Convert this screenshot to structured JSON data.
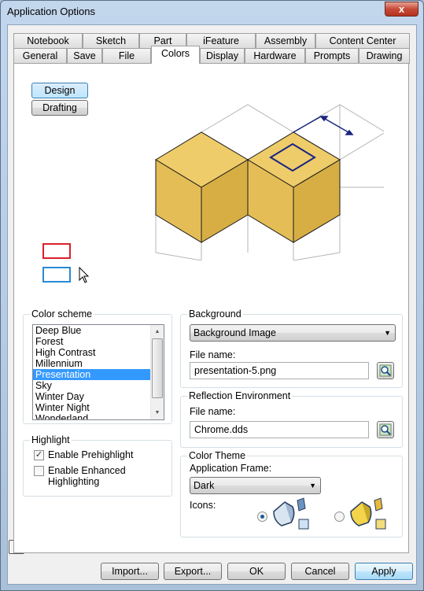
{
  "window": {
    "title": "Application Options",
    "close_label": "x"
  },
  "tabs": {
    "row1": [
      "Notebook",
      "Sketch",
      "Part",
      "iFeature",
      "Assembly",
      "Content Center"
    ],
    "row2": [
      "General",
      "Save",
      "File",
      "Colors",
      "Display",
      "Hardware",
      "Prompts",
      "Drawing"
    ],
    "active": "Colors"
  },
  "mode_buttons": {
    "design": "Design",
    "drafting": "Drafting",
    "active": "Design"
  },
  "color_scheme": {
    "label": "Color scheme",
    "items": [
      "Deep Blue",
      "Forest",
      "High Contrast",
      "Millennium",
      "Presentation",
      "Sky",
      "Winter Day",
      "Winter Night",
      "Wonderland"
    ],
    "selected": "Presentation"
  },
  "highlight": {
    "label": "Highlight",
    "prehighlight_label": "Enable Prehighlight",
    "prehighlight_checked": true,
    "enhanced_label_line1": "Enable Enhanced",
    "enhanced_label_line2": "Highlighting",
    "enhanced_checked": false
  },
  "background": {
    "label": "Background",
    "type_value": "Background Image",
    "file_label": "File name:",
    "file_value": "presentation-5.png"
  },
  "reflection": {
    "label": "Reflection Environment",
    "file_label": "File name:",
    "file_value": "Chrome.dds"
  },
  "color_theme": {
    "label": "Color Theme",
    "app_frame_label": "Application Frame:",
    "app_frame_value": "Dark",
    "icons_label": "Icons:"
  },
  "footer": {
    "import_label": "Import...",
    "export_label": "Export...",
    "ok_label": "OK",
    "cancel_label": "Cancel",
    "apply_label": "Apply",
    "help_label": "?"
  },
  "colors": {
    "cube_fill": "#e4bd56",
    "highlight_red": "#d8222a",
    "highlight_blue": "#2a8ad6",
    "selection": "#3399ff"
  }
}
